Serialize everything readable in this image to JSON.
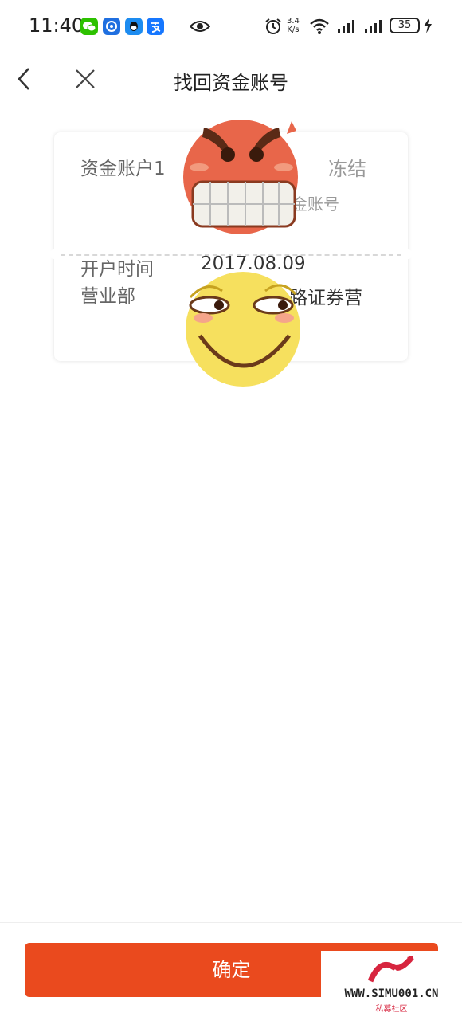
{
  "status_bar": {
    "time": "11:40",
    "net_speed_value": "3.4",
    "net_speed_unit": "K/s",
    "battery": "35",
    "icons": [
      "wechat-icon",
      "app-icon-blue",
      "qq-icon",
      "alipay-icon",
      "eye-icon",
      "alarm-icon",
      "wifi-icon",
      "signal-icon",
      "signal-icon",
      "battery-icon",
      "charging-icon"
    ]
  },
  "nav": {
    "title": "找回资金账号",
    "back_icon": "chevron-left-icon",
    "close_icon": "close-icon"
  },
  "account_card": {
    "account_label": "资金账户1",
    "status": "冻结",
    "sub_label_visible": "金账号",
    "rows": [
      {
        "label": "开户时间",
        "value": "2017.08.09"
      },
      {
        "label": "营业部",
        "value_visible": "路证券营"
      }
    ]
  },
  "stickers": [
    "angry-emoji",
    "smirk-emoji"
  ],
  "footer": {
    "confirm_label": "确定"
  },
  "watermark": {
    "text": "WWW.SIMU001.CN",
    "sub": "私募社区"
  },
  "colors": {
    "accent": "#ea4a1e",
    "status_text": "#999999"
  }
}
